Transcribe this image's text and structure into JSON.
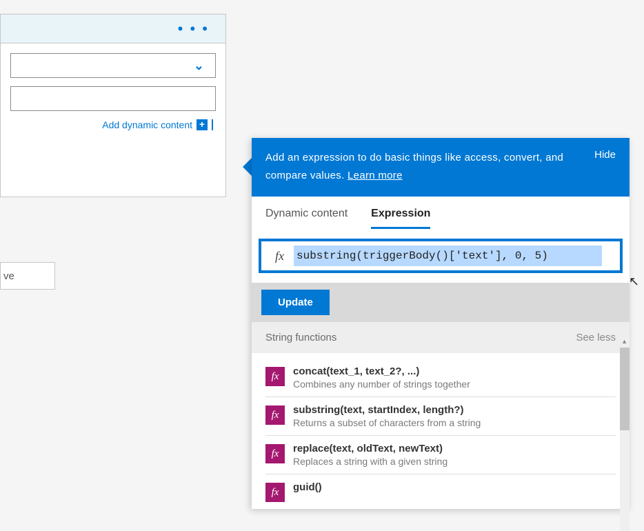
{
  "action_card": {
    "more_menu": "• • •",
    "add_dynamic_label": "Add dynamic content"
  },
  "save_label": "ve",
  "panel": {
    "header_text_prefix": "Add an expression to do basic things like access, convert, and compare values. ",
    "learn_more": "Learn more",
    "hide": "Hide",
    "tabs": {
      "dynamic": "Dynamic content",
      "expression": "Expression"
    },
    "fx": "fx",
    "expression_value": "substring(triggerBody()['text'], 0, 5)",
    "update": "Update",
    "category": "String functions",
    "see_less": "See less",
    "functions": [
      {
        "sig": "concat(text_1, text_2?, ...)",
        "desc": "Combines any number of strings together"
      },
      {
        "sig": "substring(text, startIndex, length?)",
        "desc": "Returns a subset of characters from a string"
      },
      {
        "sig": "replace(text, oldText, newText)",
        "desc": "Replaces a string with a given string"
      },
      {
        "sig": "guid()",
        "desc": ""
      }
    ]
  }
}
